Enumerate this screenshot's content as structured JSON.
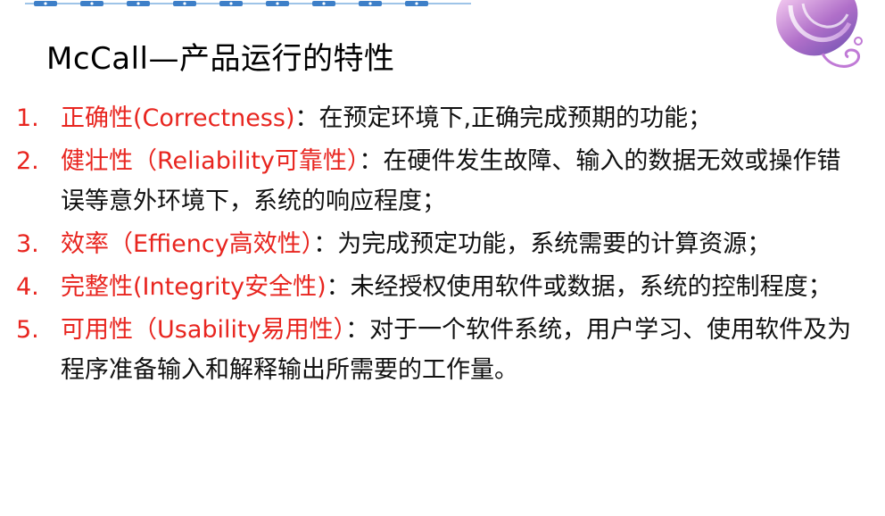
{
  "slide": {
    "title": "McCall—产品运行的特性"
  },
  "items": [
    {
      "number": "1.",
      "term": "正确性(Correctness)",
      "description": "：在预定环境下,正确完成预期的功能；"
    },
    {
      "number": "2.",
      "term": "健壮性（Reliability可靠性）",
      "description": "：在硬件发生故障、输入的数据无效或操作错误等意外环境下，系统的响应程度；"
    },
    {
      "number": "3.",
      "term": "效率（Effiency高效性）",
      "description": "：为完成预定功能，系统需要的计算资源；"
    },
    {
      "number": "4.",
      "term": "完整性(Integrity安全性)",
      "description": "：未经授权使用软件或数据，系统的控制程度；"
    },
    {
      "number": "5.",
      "term": "可用性（Usability易用性）",
      "description": "：对于一个软件系统，用户学习、使用软件及为程序准备输入和解释输出所需要的工作量。"
    }
  ],
  "colors": {
    "accent": "#e8251f",
    "text": "#111111",
    "decoration_blue": "#4a90d9",
    "decoration_purple": "#b06fc9"
  },
  "icons": {
    "top_bar": "dotted-chain-decoration",
    "corner": "swirl-decoration"
  }
}
